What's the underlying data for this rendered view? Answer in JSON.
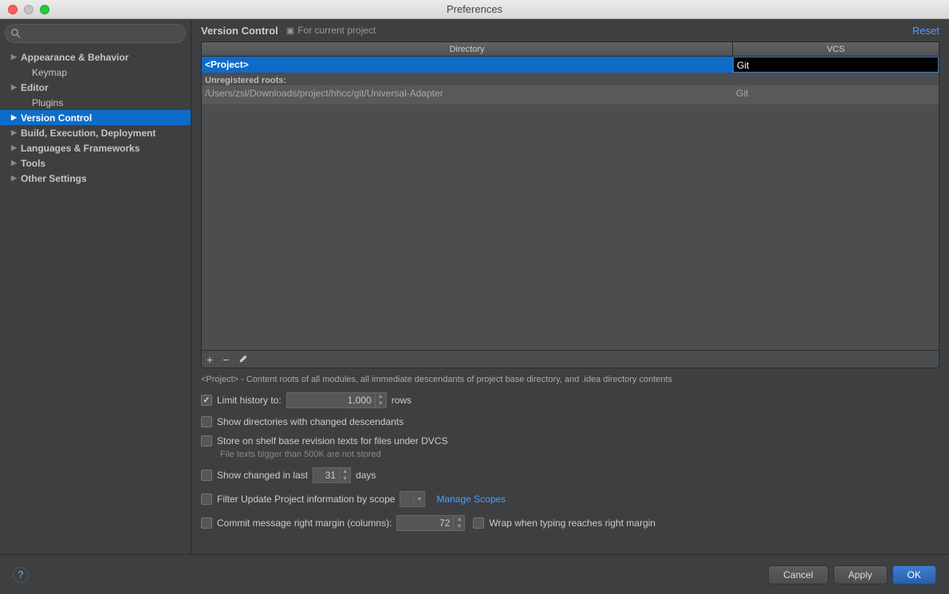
{
  "window": {
    "title": "Preferences"
  },
  "sidebar": {
    "search_placeholder": "",
    "items": [
      {
        "label": "Appearance & Behavior",
        "expandable": true
      },
      {
        "label": "Keymap",
        "expandable": false,
        "child": true
      },
      {
        "label": "Editor",
        "expandable": true
      },
      {
        "label": "Plugins",
        "expandable": false,
        "child": true
      },
      {
        "label": "Version Control",
        "expandable": true,
        "selected": true
      },
      {
        "label": "Build, Execution, Deployment",
        "expandable": true
      },
      {
        "label": "Languages & Frameworks",
        "expandable": true
      },
      {
        "label": "Tools",
        "expandable": true
      },
      {
        "label": "Other Settings",
        "expandable": true
      }
    ]
  },
  "breadcrumb": {
    "title": "Version Control",
    "subtitle": "For current project",
    "reset": "Reset"
  },
  "table": {
    "headers": {
      "directory": "Directory",
      "vcs": "VCS"
    },
    "selected_row": {
      "directory": "<Project>",
      "vcs": "Git"
    },
    "unregistered_label": "Unregistered roots:",
    "unregistered_rows": [
      {
        "directory": "/Users/zsl/Downloads/project/hhcc/git/Universal-Adapter",
        "vcs": "Git"
      }
    ]
  },
  "description": "<Project> - Content roots of all modules, all immediate descendants of project base directory, and .idea directory contents",
  "options": {
    "limit_history": {
      "label_pre": "Limit history to:",
      "value": "1,000",
      "label_post": "rows",
      "checked": true
    },
    "show_directories": {
      "label": "Show directories with changed descendants",
      "checked": false
    },
    "store_shelf": {
      "label": "Store on shelf base revision texts for files under DVCS",
      "sub": "File texts bigger than 500K are not stored",
      "checked": false
    },
    "show_changed": {
      "label_pre": "Show changed in last",
      "value": "31",
      "label_post": "days",
      "checked": false
    },
    "filter_update": {
      "label": "Filter Update Project information by scope",
      "manage": "Manage Scopes",
      "checked": false
    },
    "commit_margin": {
      "label": "Commit message right margin (columns):",
      "value": "72",
      "wrap_label": "Wrap when typing reaches right margin",
      "checked": false,
      "wrap_checked": false
    }
  },
  "footer": {
    "cancel": "Cancel",
    "apply": "Apply",
    "ok": "OK"
  }
}
